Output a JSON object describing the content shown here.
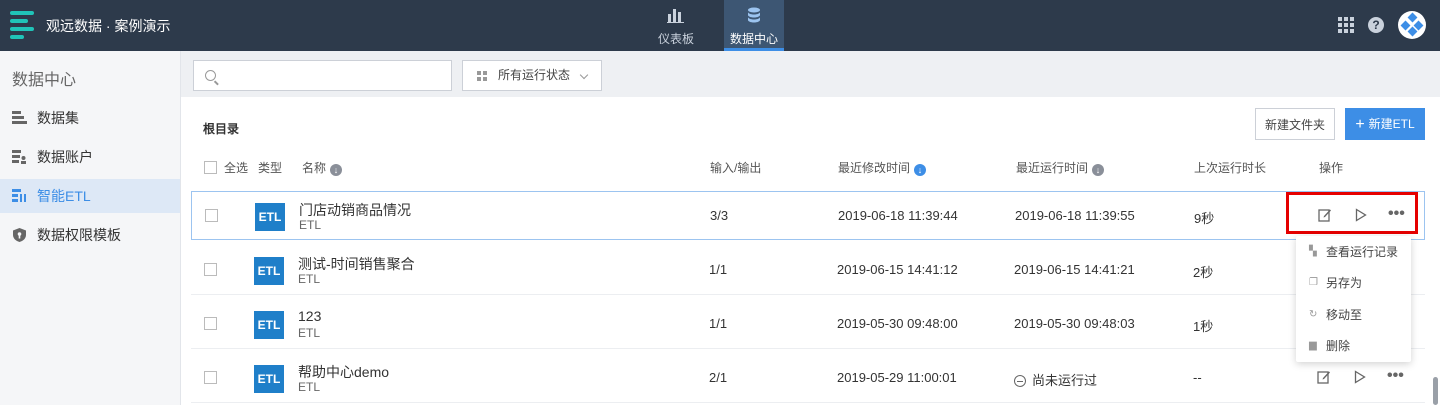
{
  "app": {
    "title": "观远数据 · 案例演示"
  },
  "nav": {
    "items": [
      {
        "label": "仪表板"
      },
      {
        "label": "数据中心"
      }
    ]
  },
  "sidebar": {
    "title": "数据中心",
    "items": [
      {
        "label": "数据集"
      },
      {
        "label": "数据账户"
      },
      {
        "label": "智能ETL"
      },
      {
        "label": "数据权限模板"
      }
    ]
  },
  "filters": {
    "search_value": "",
    "status_label": "所有运行状态"
  },
  "breadcrumb": "根目录",
  "buttons": {
    "new_folder": "新建文件夹",
    "new_etl": "新建ETL"
  },
  "table": {
    "headers": {
      "select_all": "全选",
      "type": "类型",
      "name": "名称",
      "io": "输入/输出",
      "modified": "最近修改时间",
      "last_run": "最近运行时间",
      "duration": "上次运行时长",
      "ops": "操作"
    },
    "rows": [
      {
        "name": "门店动销商品情况",
        "type": "ETL",
        "badge": "ETL",
        "io": "3/3",
        "modified": "2019-06-18 11:39:44",
        "last_run": "2019-06-18 11:39:55",
        "duration": "9秒"
      },
      {
        "name": "测试-时间销售聚合",
        "type": "ETL",
        "badge": "ETL",
        "io": "1/1",
        "modified": "2019-06-15 14:41:12",
        "last_run": "2019-06-15 14:41:21",
        "duration": "2秒"
      },
      {
        "name": "123",
        "type": "ETL",
        "badge": "ETL",
        "io": "1/1",
        "modified": "2019-05-30 09:48:00",
        "last_run": "2019-05-30 09:48:03",
        "duration": "1秒"
      },
      {
        "name": "帮助中心demo",
        "type": "ETL",
        "badge": "ETL",
        "io": "2/1",
        "modified": "2019-05-29 11:00:01",
        "last_run": "尚未运行过",
        "duration": "--"
      }
    ]
  },
  "dropdown": {
    "items": [
      {
        "label": "查看运行记录"
      },
      {
        "label": "另存为"
      },
      {
        "label": "移动至"
      },
      {
        "label": "删除"
      }
    ]
  },
  "colors": {
    "topbar": "#2d3a4b",
    "accent": "#3d8ee6",
    "etl_badge": "#1f7fc9",
    "highlight": "#e50000"
  }
}
